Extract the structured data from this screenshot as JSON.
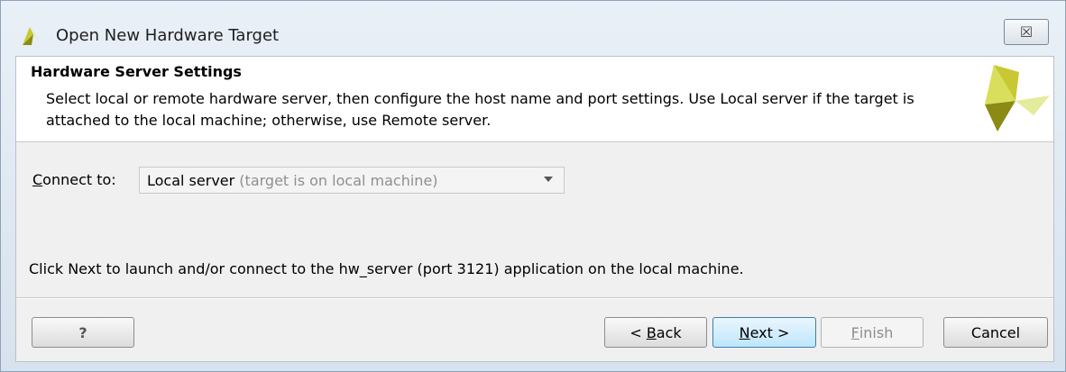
{
  "window": {
    "title": "Open New Hardware Target",
    "close_glyph": "☒"
  },
  "header": {
    "title": "Hardware Server Settings",
    "description": "Select local or remote hardware server, then configure the host name and port settings. Use Local server if the target is attached to the local machine; otherwise, use Remote server.",
    "logo_icon": "xilinx-logo-icon"
  },
  "connect": {
    "label_mnemonic": "C",
    "label_rest": "onnect to:",
    "selected_value": "Local server",
    "selected_hint": "(target is on local machine)"
  },
  "info_text": "Click Next to launch and/or connect to the hw_server (port 3121) application on the local machine.",
  "buttons": {
    "help": "?",
    "back_prefix": "< ",
    "back_mnemonic": "B",
    "back_rest": "ack",
    "next_mnemonic": "N",
    "next_rest": "ext >",
    "finish_mnemonic": "F",
    "finish_rest": "inish",
    "cancel": "Cancel"
  },
  "colors": {
    "logo_dark": "#8a8a14",
    "logo_mid": "#c8c832",
    "logo_light": "#e5eb9c"
  }
}
